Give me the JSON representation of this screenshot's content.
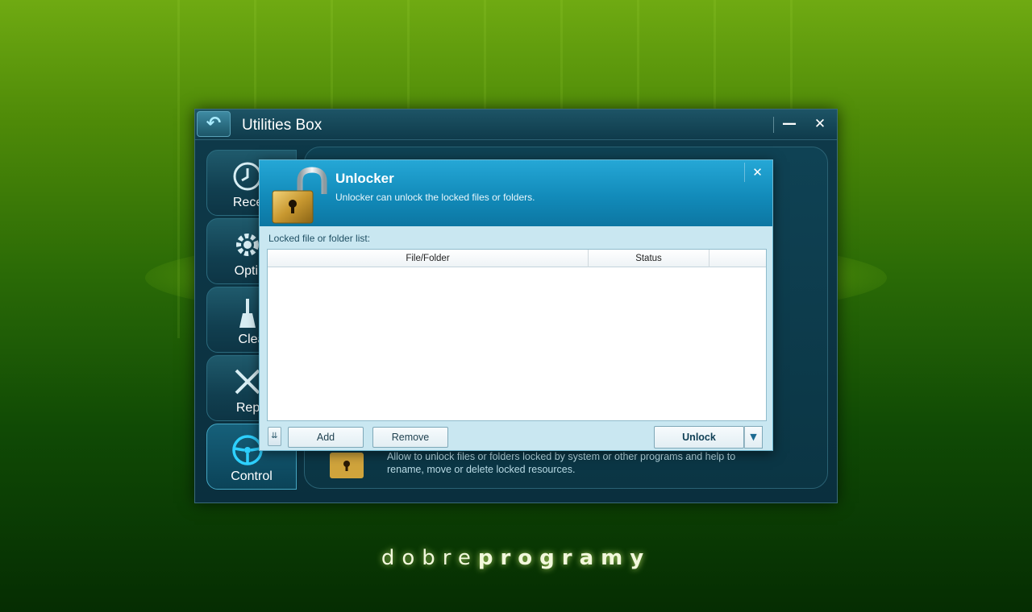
{
  "desktop": {
    "watermark_light": "dobre",
    "watermark_bold": "programy"
  },
  "main_window": {
    "title": "Utilities Box",
    "back_icon": "back-arrow-icon",
    "minimize_label": "—",
    "close_label": "✕",
    "nav": [
      {
        "label": "Recen",
        "icon": "clock-icon"
      },
      {
        "label": "Optim",
        "icon": "gear-icon"
      },
      {
        "label": "Clea",
        "icon": "broom-icon"
      },
      {
        "label": "Repa",
        "icon": "tools-icon"
      },
      {
        "label": "Control",
        "icon": "steering-wheel-icon"
      }
    ],
    "panel_description": "Allow to unlock files or folders locked by system or other programs and help to rename, move or delete locked resources."
  },
  "dialog": {
    "title": "Unlocker",
    "subtitle": "Unlocker can unlock the locked files or folders.",
    "close_label": "✕",
    "list_label": "Locked file or folder list:",
    "columns": [
      "File/Folder",
      "Status"
    ],
    "rows": [],
    "buttons": {
      "options": "⇊",
      "add": "Add",
      "remove": "Remove",
      "unlock": "Unlock",
      "unlock_dropdown": "▼"
    }
  },
  "colors": {
    "header_blue": "#128bba",
    "window_dark": "#0e3a4a",
    "dialog_body": "#c9e7f1"
  }
}
